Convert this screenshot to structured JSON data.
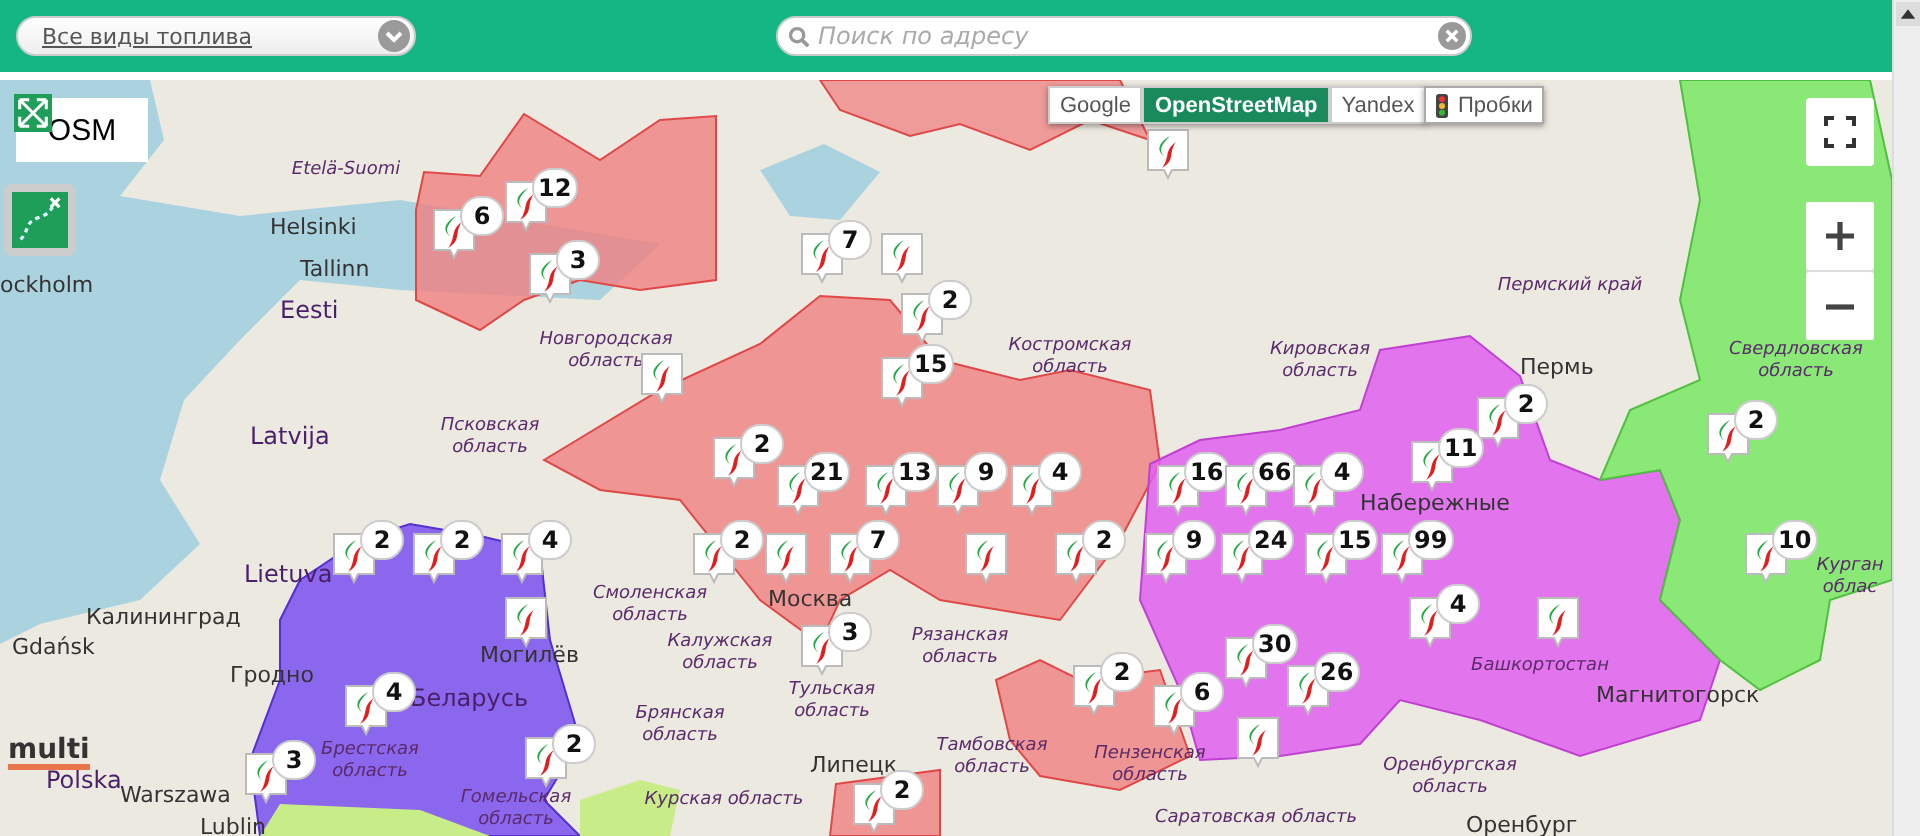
{
  "toolbar": {
    "fuel_select": {
      "value": "Все виды топлива"
    },
    "search": {
      "placeholder": "Поиск по адресу"
    }
  },
  "map_types": [
    {
      "label": "Google",
      "selected": false
    },
    {
      "label": "OpenStreetMap",
      "selected": true
    },
    {
      "label": "Yandex",
      "selected": false
    }
  ],
  "traffic": {
    "label": "Пробки",
    "on": false
  },
  "layer_label": "OSM",
  "place_labels": [
    {
      "text": "Etelä-Suomi",
      "kind": "region"
    },
    {
      "text": "Helsinki",
      "kind": "city"
    },
    {
      "text": "Tallinn",
      "kind": "city"
    },
    {
      "text": "ockholm",
      "kind": "city"
    },
    {
      "text": "Eesti",
      "kind": "country"
    },
    {
      "text": "Latvija",
      "kind": "country"
    },
    {
      "text": "Lietuva",
      "kind": "country"
    },
    {
      "text": "Калининград",
      "kind": "city"
    },
    {
      "text": "Gdańsk",
      "kind": "city"
    },
    {
      "text": "Гродно",
      "kind": "city"
    },
    {
      "text": "Polska",
      "kind": "country"
    },
    {
      "text": "Warszawa",
      "kind": "city"
    },
    {
      "text": "Lublin",
      "kind": "city"
    },
    {
      "text": "Москва",
      "kind": "city"
    },
    {
      "text": "Могилёв",
      "kind": "city"
    },
    {
      "text": "Беларусь",
      "kind": "country"
    },
    {
      "text": "Пермь",
      "kind": "city"
    },
    {
      "text": "Набережные",
      "kind": "city"
    },
    {
      "text": "Башкортостан",
      "kind": "region"
    },
    {
      "text": "Магнитогорск",
      "kind": "city"
    },
    {
      "text": "Оренбург",
      "kind": "city"
    },
    {
      "text": "Липецк",
      "kind": "city"
    },
    {
      "text": "Смоленская область",
      "kind": "region"
    },
    {
      "text": "Калужская область",
      "kind": "region"
    },
    {
      "text": "Тульская область",
      "kind": "region"
    },
    {
      "text": "Рязанская область",
      "kind": "region"
    },
    {
      "text": "Псковская область",
      "kind": "region"
    },
    {
      "text": "Новгородская область",
      "kind": "region"
    },
    {
      "text": "Костромская область",
      "kind": "region"
    },
    {
      "text": "Кировская область",
      "kind": "region"
    },
    {
      "text": "Пермский край",
      "kind": "region"
    },
    {
      "text": "Свердловская область",
      "kind": "region"
    },
    {
      "text": "Брянская область",
      "kind": "region"
    },
    {
      "text": "Тамбовская область",
      "kind": "region"
    },
    {
      "text": "Пензенская область",
      "kind": "region"
    },
    {
      "text": "Оренбургская область",
      "kind": "region"
    },
    {
      "text": "Саратовская область",
      "kind": "region"
    },
    {
      "text": "Курская область",
      "kind": "region"
    },
    {
      "text": "Брестская область",
      "kind": "region"
    },
    {
      "text": "Гомельская область",
      "kind": "region"
    },
    {
      "text": "Курган облас",
      "kind": "region"
    }
  ],
  "markers": [
    {
      "kind": "plain"
    },
    {
      "kind": "counted",
      "count": "12"
    },
    {
      "kind": "counted",
      "count": "6"
    },
    {
      "kind": "counted",
      "count": "7"
    },
    {
      "kind": "plain"
    },
    {
      "kind": "counted",
      "count": "3"
    },
    {
      "kind": "counted",
      "count": "2"
    },
    {
      "kind": "plain"
    },
    {
      "kind": "counted",
      "count": "15"
    },
    {
      "kind": "counted",
      "count": "2"
    },
    {
      "kind": "counted",
      "count": "2"
    },
    {
      "kind": "counted",
      "count": "2"
    },
    {
      "kind": "counted",
      "count": "11"
    },
    {
      "kind": "counted",
      "count": "21"
    },
    {
      "kind": "counted",
      "count": "13"
    },
    {
      "kind": "counted",
      "count": "9"
    },
    {
      "kind": "counted",
      "count": "4"
    },
    {
      "kind": "counted",
      "count": "16"
    },
    {
      "kind": "counted",
      "count": "66"
    },
    {
      "kind": "counted",
      "count": "4"
    },
    {
      "kind": "counted",
      "count": "2"
    },
    {
      "kind": "counted",
      "count": "2"
    },
    {
      "kind": "counted",
      "count": "4"
    },
    {
      "kind": "counted",
      "count": "2"
    },
    {
      "kind": "plain"
    },
    {
      "kind": "counted",
      "count": "7"
    },
    {
      "kind": "plain"
    },
    {
      "kind": "counted",
      "count": "2"
    },
    {
      "kind": "counted",
      "count": "9"
    },
    {
      "kind": "counted",
      "count": "24"
    },
    {
      "kind": "counted",
      "count": "15"
    },
    {
      "kind": "counted",
      "count": "99"
    },
    {
      "kind": "counted",
      "count": "10"
    },
    {
      "kind": "plain"
    },
    {
      "kind": "counted",
      "count": "4"
    },
    {
      "kind": "plain"
    },
    {
      "kind": "counted",
      "count": "3"
    },
    {
      "kind": "counted",
      "count": "30"
    },
    {
      "kind": "counted",
      "count": "2"
    },
    {
      "kind": "counted",
      "count": "26"
    },
    {
      "kind": "counted",
      "count": "4"
    },
    {
      "kind": "counted",
      "count": "6"
    },
    {
      "kind": "plain"
    },
    {
      "kind": "counted",
      "count": "2"
    },
    {
      "kind": "counted",
      "count": "3"
    },
    {
      "kind": "counted",
      "count": "2"
    }
  ],
  "logo": "multi"
}
